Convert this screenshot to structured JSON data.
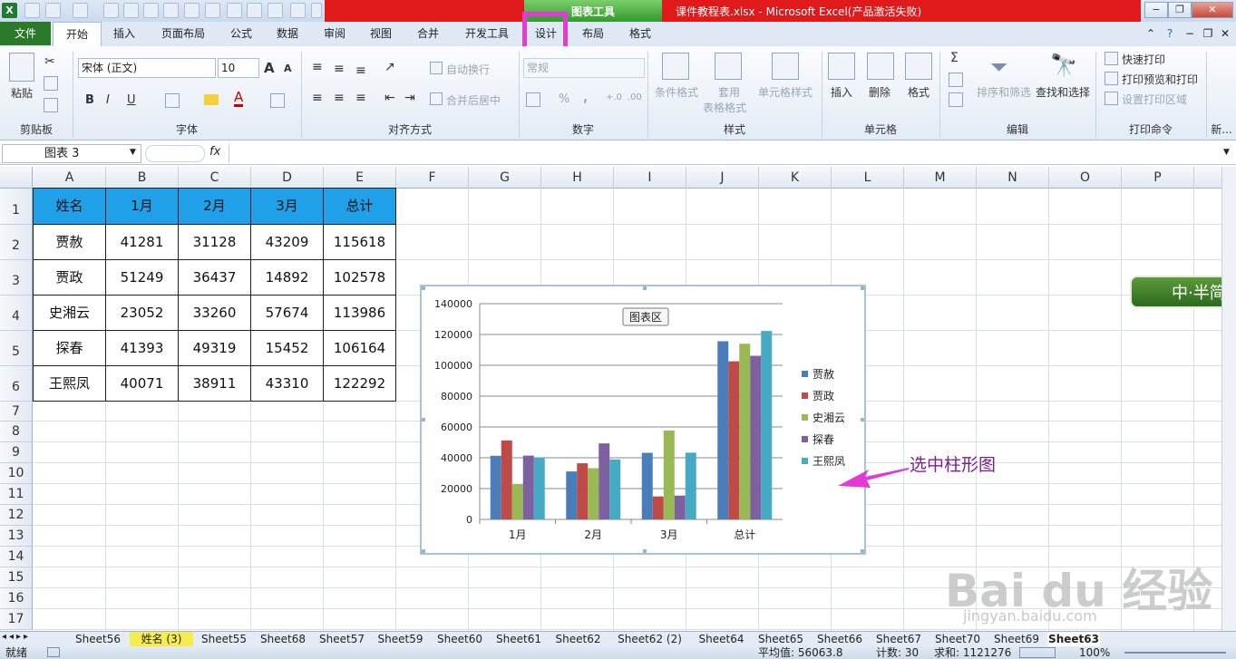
{
  "window": {
    "title": "课件教程表.xlsx - Microsoft Excel(产品激活失败)",
    "context_tab_group": "图表工具",
    "controls": [
      "−",
      "❐",
      "✕"
    ]
  },
  "tabs": {
    "file": "文件",
    "items": [
      "开始",
      "插入",
      "页面布局",
      "公式",
      "数据",
      "审阅",
      "视图",
      "合并",
      "开发工具",
      "设计",
      "布局",
      "格式"
    ]
  },
  "ribbon": {
    "clipboard": {
      "paste": "粘贴",
      "label": "剪贴板"
    },
    "font": {
      "name": "宋体 (正文)",
      "size": "10",
      "label": "字体",
      "bold": "B",
      "italic": "I",
      "underline": "U",
      "grow": "A",
      "shrink": "A"
    },
    "alignment": {
      "wrap": "自动换行",
      "merge": "合并后居中",
      "label": "对齐方式"
    },
    "number": {
      "format": "常规",
      "percent": "%",
      "comma": ",",
      "label": "数字"
    },
    "styles": {
      "conditional": "条件格式",
      "table_line1": "套用",
      "table_line2": "表格格式",
      "cell_style": "单元格样式",
      "label": "样式"
    },
    "cells": {
      "insert": "插入",
      "delete": "删除",
      "format": "格式",
      "label": "单元格"
    },
    "editing": {
      "sigma": "Σ",
      "sort": "排序和筛选",
      "find": "查找和选择",
      "label": "编辑"
    },
    "print": {
      "quick": "快速打印",
      "preview": "打印预览和打印",
      "area": "设置打印区域",
      "label": "打印命令",
      "more": "新..."
    }
  },
  "formula": {
    "namebox": "图表 3",
    "fx": "fx",
    "value": ""
  },
  "columns": [
    "A",
    "B",
    "C",
    "D",
    "E",
    "F",
    "G",
    "H",
    "I",
    "J",
    "K",
    "L",
    "M",
    "N",
    "O",
    "P"
  ],
  "rows": [
    "1",
    "2",
    "3",
    "4",
    "5",
    "6",
    "7",
    "8",
    "9",
    "10",
    "11",
    "12",
    "13",
    "14",
    "15",
    "16",
    "17"
  ],
  "table": {
    "header": [
      "姓名",
      "1月",
      "2月",
      "3月",
      "总计"
    ],
    "rows": [
      [
        "贾赦",
        "41281",
        "31128",
        "43209",
        "115618"
      ],
      [
        "贾政",
        "51249",
        "36437",
        "14892",
        "102578"
      ],
      [
        "史湘云",
        "23052",
        "33260",
        "57674",
        "113986"
      ],
      [
        "探春",
        "41393",
        "49319",
        "15452",
        "106164"
      ],
      [
        "王熙凤",
        "40071",
        "38911",
        "43310",
        "122292"
      ]
    ]
  },
  "chart_data": {
    "type": "bar",
    "categories": [
      "1月",
      "2月",
      "3月",
      "总计"
    ],
    "series": [
      {
        "name": "贾赦",
        "values": [
          41281,
          31128,
          43209,
          115618
        ],
        "color": "#4a7ebb"
      },
      {
        "name": "贾政",
        "values": [
          51249,
          36437,
          14892,
          102578
        ],
        "color": "#be4b48"
      },
      {
        "name": "史湘云",
        "values": [
          23052,
          33260,
          57674,
          113986
        ],
        "color": "#98b954"
      },
      {
        "name": "探春",
        "values": [
          41393,
          49319,
          15452,
          106164
        ],
        "color": "#7d60a0"
      },
      {
        "name": "王熙凤",
        "values": [
          40071,
          38911,
          43310,
          122292
        ],
        "color": "#46aac5"
      }
    ],
    "ylim": [
      0,
      140000
    ],
    "yticks": [
      "0",
      "20000",
      "40000",
      "60000",
      "80000",
      "100000",
      "120000",
      "140000"
    ],
    "grid": true,
    "legend": "right",
    "tooltip": "图表区"
  },
  "sheets": [
    "Sheet56",
    "姓名 (3)",
    "Sheet55",
    "Sheet68",
    "Sheet57",
    "Sheet59",
    "Sheet60",
    "Sheet61",
    "Sheet62",
    "Sheet62 (2)",
    "Sheet64",
    "Sheet65",
    "Sheet66",
    "Sheet67",
    "Sheet70",
    "Sheet69",
    "Sheet63"
  ],
  "status": {
    "ready": "就绪",
    "average": "平均值: 56063.8",
    "count": "计数: 30",
    "sum": "求和: 1121276",
    "zoom": "100%"
  },
  "annotation": "选中柱形图",
  "badge": "中·半简",
  "watermark": "Bai du 经验",
  "watermark_url": "jingyan.baidu.com"
}
